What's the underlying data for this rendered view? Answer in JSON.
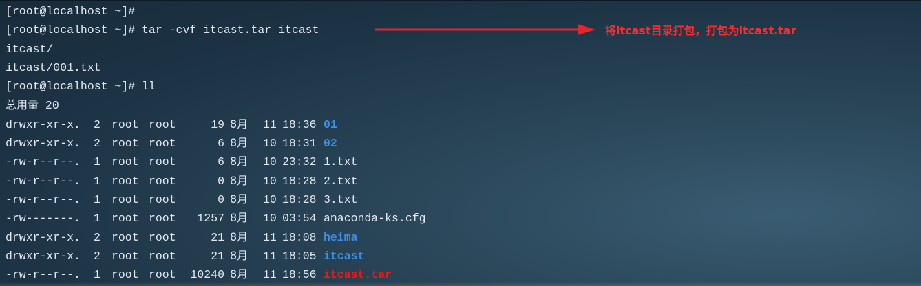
{
  "terminal": {
    "lines": [
      "[root@localhost ~]#",
      "[root@localhost ~]# tar -cvf itcast.tar itcast",
      "itcast/",
      "itcast/001.txt",
      "[root@localhost ~]# ll"
    ],
    "total_label": "总用量",
    "total_value": "20",
    "listing": [
      {
        "perm": "drwxr-xr-x.",
        "links": "2",
        "user": "root",
        "group": "root",
        "size": "19",
        "month": "8月",
        "day": "11",
        "time": "18:36",
        "name": "01",
        "kind": "dir"
      },
      {
        "perm": "drwxr-xr-x.",
        "links": "2",
        "user": "root",
        "group": "root",
        "size": "6",
        "month": "8月",
        "day": "10",
        "time": "18:31",
        "name": "02",
        "kind": "dir"
      },
      {
        "perm": "-rw-r--r--.",
        "links": "1",
        "user": "root",
        "group": "root",
        "size": "6",
        "month": "8月",
        "day": "10",
        "time": "23:32",
        "name": "1.txt",
        "kind": "file"
      },
      {
        "perm": "-rw-r--r--.",
        "links": "1",
        "user": "root",
        "group": "root",
        "size": "0",
        "month": "8月",
        "day": "10",
        "time": "18:28",
        "name": "2.txt",
        "kind": "file"
      },
      {
        "perm": "-rw-r--r--.",
        "links": "1",
        "user": "root",
        "group": "root",
        "size": "0",
        "month": "8月",
        "day": "10",
        "time": "18:28",
        "name": "3.txt",
        "kind": "file"
      },
      {
        "perm": "-rw-------.",
        "links": "1",
        "user": "root",
        "group": "root",
        "size": "1257",
        "month": "8月",
        "day": "10",
        "time": "03:54",
        "name": "anaconda-ks.cfg",
        "kind": "file"
      },
      {
        "perm": "drwxr-xr-x.",
        "links": "2",
        "user": "root",
        "group": "root",
        "size": "21",
        "month": "8月",
        "day": "11",
        "time": "18:08",
        "name": "heima",
        "kind": "dir"
      },
      {
        "perm": "drwxr-xr-x.",
        "links": "2",
        "user": "root",
        "group": "root",
        "size": "21",
        "month": "8月",
        "day": "11",
        "time": "18:05",
        "name": "itcast",
        "kind": "dir"
      },
      {
        "perm": "-rw-r--r--.",
        "links": "1",
        "user": "root",
        "group": "root",
        "size": "10240",
        "month": "8月",
        "day": "11",
        "time": "18:56",
        "name": "itcast.tar",
        "kind": "archive"
      }
    ]
  },
  "annotation": {
    "text": "将itcast目录打包，打包为itcast.tar",
    "color": "#ff2b2b"
  },
  "colors": {
    "text": "#e2e7ec",
    "directory": "#3d8ee8",
    "archive": "#e51c1c"
  }
}
